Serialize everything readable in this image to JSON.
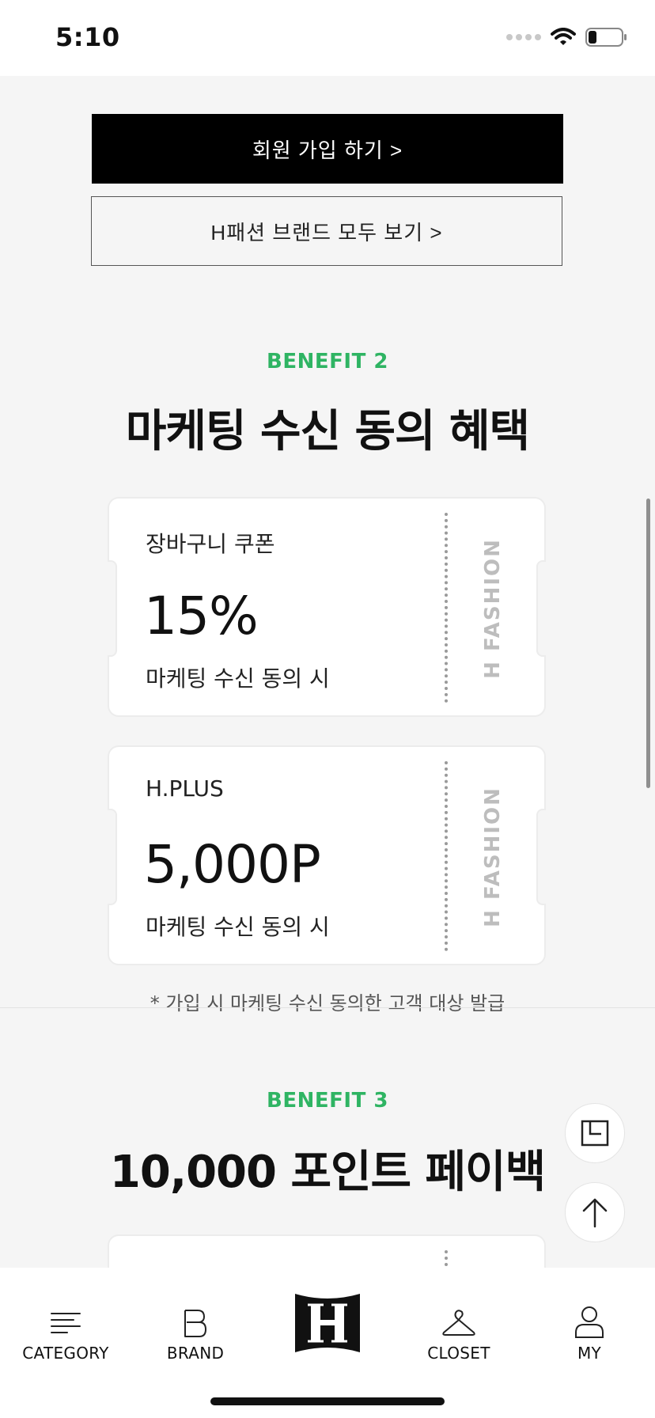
{
  "status_bar": {
    "time": "5:10"
  },
  "buttons": {
    "join": "회원 가입 하기  >",
    "all_brands": "H패션 브랜드 모두 보기  >"
  },
  "benefit2": {
    "label": "BENEFIT 2",
    "title": "마케팅 수신 동의 혜택",
    "coupons": [
      {
        "subtitle": "장바구니 쿠폰",
        "value": "15%",
        "condition": "마케팅 수신 동의 시",
        "brand": "H FASHION"
      },
      {
        "subtitle": "H.PLUS",
        "value": "5,000P",
        "condition": "마케팅 수신 동의 시",
        "brand": "H FASHION"
      }
    ],
    "notice": "* 가입 시 마케팅 수신 동의한 고객 대상 발급"
  },
  "benefit3": {
    "label": "BENEFIT 3",
    "title": "10,000 포인트 페이백"
  },
  "tabbar": {
    "items": [
      {
        "label": "CATEGORY",
        "icon": "category-icon"
      },
      {
        "label": "BRAND",
        "icon": "brand-icon"
      },
      {
        "label": "",
        "icon": "home-logo-icon"
      },
      {
        "label": "CLOSET",
        "icon": "hanger-icon"
      },
      {
        "label": "MY",
        "icon": "person-icon"
      }
    ]
  },
  "colors": {
    "accent": "#2fb463",
    "black": "#000000",
    "background": "#f5f5f5"
  }
}
